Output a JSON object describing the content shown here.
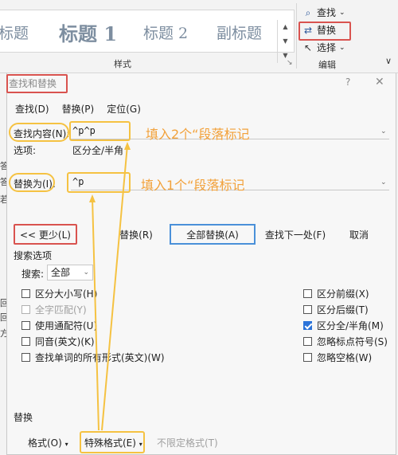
{
  "ribbon": {
    "styles": [
      "标题",
      "标题 1",
      "标题 2",
      "副标题"
    ],
    "styles_group_label": "样式",
    "find_label": "查找",
    "replace_label": "替换",
    "select_label": "选择",
    "editing_group_label": "编辑",
    "launcher_glyph": "↘",
    "collapse_glyph": "∨"
  },
  "dialog": {
    "title": "查找和替换",
    "help": "?",
    "close": "✕",
    "tabs": [
      "查找(D)",
      "替换(P)",
      "定位(G)"
    ],
    "find_label": "查找内容(N):",
    "find_value": "^p^p",
    "options_label": "选项:",
    "options_value": "区分全/半角",
    "replace_label": "替换为(I):",
    "replace_value": "^p",
    "annotation_find": "填入2个“段落标记",
    "annotation_replace": "填入1个“段落标记",
    "buttons": {
      "less": "<< 更少(L)",
      "replace": "替换(R)",
      "replace_all": "全部替换(A)",
      "find_next": "查找下一处(F)",
      "cancel": "取消"
    },
    "search_options_label": "搜索选项",
    "search_label": "搜索:",
    "search_value": "全部",
    "left_options": [
      {
        "label": "区分大小写(H)",
        "checked": false,
        "disabled": false
      },
      {
        "label": "全字匹配(Y)",
        "checked": false,
        "disabled": true
      },
      {
        "label": "使用通配符(U)",
        "checked": false,
        "disabled": false
      },
      {
        "label": "同音(英文)(K)",
        "checked": false,
        "disabled": false
      },
      {
        "label": "查找单词的所有形式(英文)(W)",
        "checked": false,
        "disabled": false
      }
    ],
    "right_options": [
      {
        "label": "区分前缀(X)",
        "checked": false
      },
      {
        "label": "区分后缀(T)",
        "checked": false
      },
      {
        "label": "区分全/半角(M)",
        "checked": true
      },
      {
        "label": "忽略标点符号(S)",
        "checked": false
      },
      {
        "label": "忽略空格(W)",
        "checked": false
      }
    ],
    "replace_section_label": "替换",
    "format_button": "格式(O)",
    "special_button": "特殊格式(E)",
    "no_format_button": "不限定格式(T)"
  },
  "side_glyphs": [
    "答",
    "答",
    "若",
    "回",
    "回",
    "方"
  ],
  "colors": {
    "annotation": "#f2a13a",
    "highlight_red": "#d9534f",
    "highlight_yellow": "#f5c242",
    "highlight_blue": "#4a90d9",
    "check_blue": "#2b73d9"
  }
}
